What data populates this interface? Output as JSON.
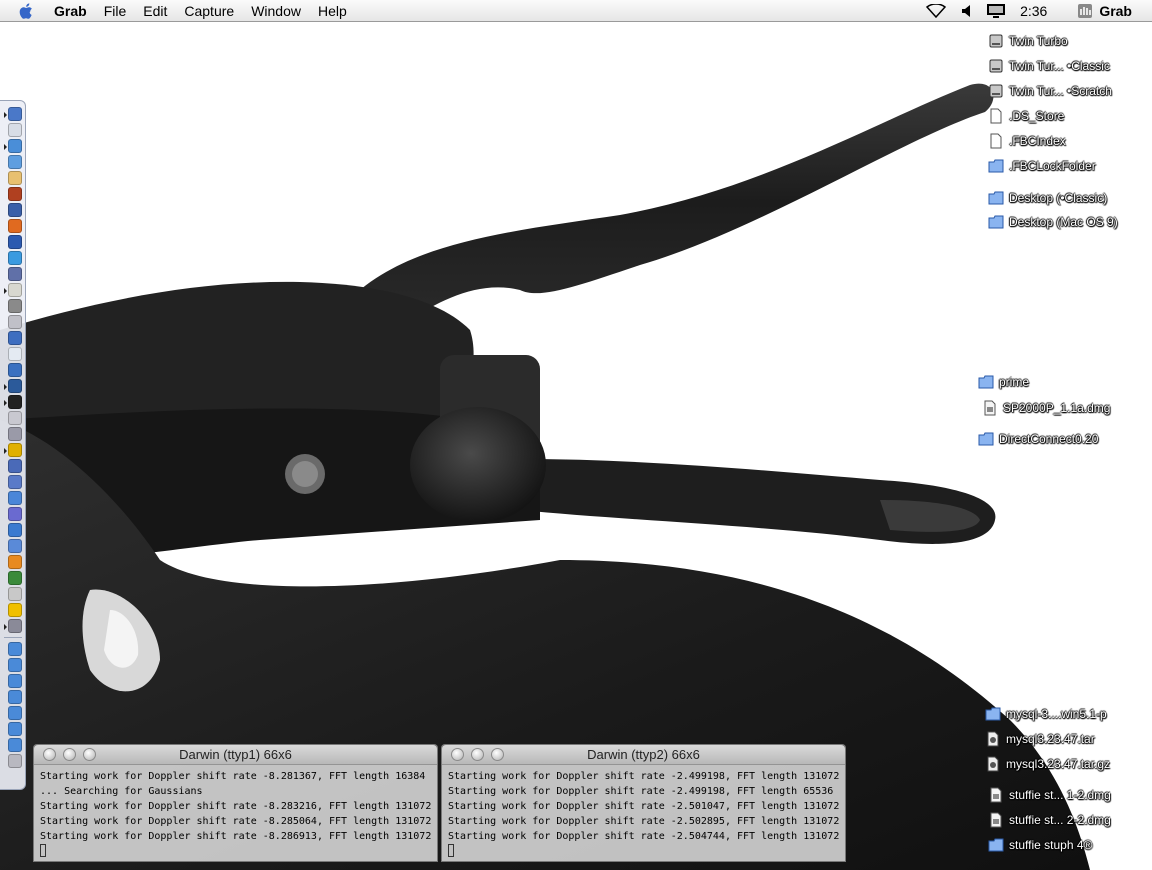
{
  "menubar": {
    "app_name": "Grab",
    "menus": [
      "File",
      "Edit",
      "Capture",
      "Window",
      "Help"
    ],
    "clock": "2:36",
    "active_app": "Grab"
  },
  "desktop_icons": [
    {
      "label": "Twin Turbo",
      "icon": "hard-disk-icon"
    },
    {
      "label": "Twin Tur... •Classic",
      "icon": "hard-disk-icon"
    },
    {
      "label": "Twin Tur... •Scratch",
      "icon": "hard-disk-icon"
    },
    {
      "label": ".DS_Store",
      "icon": "document-icon"
    },
    {
      "label": ".FBCIndex",
      "icon": "document-icon"
    },
    {
      "label": ".FBCLockFolder",
      "icon": "folder-icon"
    },
    {
      "label": "Desktop (•Classic)",
      "icon": "folder-icon"
    },
    {
      "label": "Desktop (Mac OS 9)",
      "icon": "folder-icon"
    },
    {
      "label": "prime",
      "icon": "folder-icon"
    },
    {
      "label": "SP2000P_1.1a.dmg",
      "icon": "disk-image-icon"
    },
    {
      "label": "DirectConnect0.20",
      "icon": "folder-icon"
    },
    {
      "label": "mysql-3....win5.1-p",
      "icon": "folder-icon"
    },
    {
      "label": "mysql3.23.47.tar",
      "icon": "archive-icon"
    },
    {
      "label": "mysql3.23.47.tar.gz",
      "icon": "archive-icon"
    },
    {
      "label": "stuffie st... 1-2.dmg",
      "icon": "disk-image-icon"
    },
    {
      "label": "stuffie st... 2-2.dmg",
      "icon": "disk-image-icon"
    },
    {
      "label": "stuffie stuph 4®",
      "icon": "folder-icon"
    }
  ],
  "terminals": [
    {
      "title": "Darwin  (ttyp1)  66x6",
      "lines": [
        "Starting work for Doppler shift rate -8.281367, FFT length 16384",
        "... Searching for Gaussians",
        "Starting work for Doppler shift rate -8.283216, FFT length 131072",
        "Starting work for Doppler shift rate -8.285064, FFT length 131072",
        "Starting work for Doppler shift rate -8.286913, FFT length 131072"
      ]
    },
    {
      "title": "Darwin  (ttyp2)  66x6",
      "lines": [
        "Starting work for Doppler shift rate -2.499198, FFT length 131072",
        "Starting work for Doppler shift rate -2.499198, FFT length 65536",
        "Starting work for Doppler shift rate -2.501047, FFT length 131072",
        "Starting work for Doppler shift rate -2.502895, FFT length 131072",
        "Starting work for Doppler shift rate -2.504744, FFT length 131072"
      ]
    }
  ],
  "dock_items": [
    {
      "icon": "finder-icon",
      "color": "#4a78c8"
    },
    {
      "icon": "mail-icon",
      "color": "#d8dde6"
    },
    {
      "icon": "internet-explorer-icon",
      "color": "#4a8ed8"
    },
    {
      "icon": "app-store-icon",
      "color": "#5e9ee0"
    },
    {
      "icon": "preview-icon",
      "color": "#e8c070"
    },
    {
      "icon": "itunes-icon",
      "color": "#b04020"
    },
    {
      "icon": "quicktime-icon",
      "color": "#3a5fa8"
    },
    {
      "icon": "firefox-icon",
      "color": "#e06a20"
    },
    {
      "icon": "sherlock-icon",
      "color": "#2c5ab0"
    },
    {
      "icon": "network-icon",
      "color": "#3a9ae0"
    },
    {
      "icon": "system-prefs-icon",
      "color": "#6070a8"
    },
    {
      "icon": "textedit-icon",
      "color": "#d8d8d0"
    },
    {
      "icon": "utility-icon",
      "color": "#8a8a8a"
    },
    {
      "icon": "printer-icon",
      "color": "#c0c0c8"
    },
    {
      "icon": "ichat-icon",
      "color": "#3e6ec0"
    },
    {
      "icon": "clock-icon",
      "color": "#e4eaf2"
    },
    {
      "icon": "globe-icon",
      "color": "#3a70c0"
    },
    {
      "icon": "x11-icon",
      "color": "#2b5a9a"
    },
    {
      "icon": "terminal-icon",
      "color": "#222222"
    },
    {
      "icon": "print-center-icon",
      "color": "#c8c8d0"
    },
    {
      "icon": "disk-utility-icon",
      "color": "#9a9aa8"
    },
    {
      "icon": "radiation-icon",
      "color": "#e0b000"
    },
    {
      "icon": "quicktime-player-icon",
      "color": "#4a6ab8"
    },
    {
      "icon": "app-icon",
      "color": "#5a7ac8"
    },
    {
      "icon": "network-utility-icon",
      "color": "#4a86d8"
    },
    {
      "icon": "globe-net-icon",
      "color": "#6a6ad0"
    },
    {
      "icon": "script-editor-icon",
      "color": "#3a7ad0"
    },
    {
      "icon": "accessibility-icon",
      "color": "#5a8ad8"
    },
    {
      "icon": "star-icon",
      "color": "#e88a20"
    },
    {
      "icon": "green-app-icon",
      "color": "#3a8a3a"
    },
    {
      "icon": "pen-icon",
      "color": "#c8c8c8"
    },
    {
      "icon": "sun-icon",
      "color": "#f0c000"
    },
    {
      "icon": "tools-icon",
      "color": "#8a8a98"
    },
    {
      "icon": "document-icon",
      "color": "#4a8ad8"
    },
    {
      "icon": "folder-icon",
      "color": "#4a8ad8"
    },
    {
      "icon": "folder-icon",
      "color": "#4a8ad8"
    },
    {
      "icon": "folder-icon",
      "color": "#4a8ad8"
    },
    {
      "icon": "folder-icon",
      "color": "#4a8ad8"
    },
    {
      "icon": "folder-icon",
      "color": "#4a8ad8"
    },
    {
      "icon": "folder-icon",
      "color": "#4a8ad8"
    },
    {
      "icon": "trash-icon",
      "color": "#b8b8c0"
    }
  ]
}
